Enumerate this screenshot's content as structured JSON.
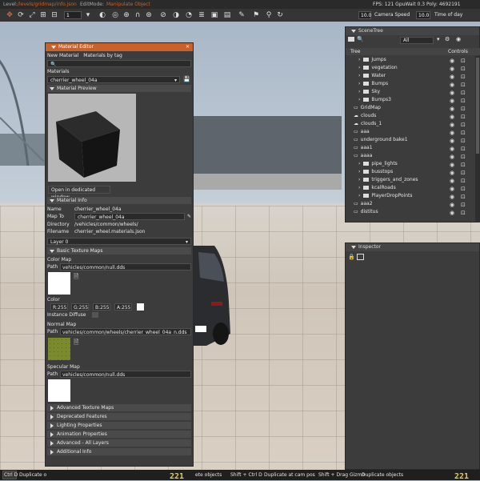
{
  "topbar": {
    "level_label": "Level:",
    "level_value": "/levels/gridmap/info.json",
    "edit_mode_label": "EditMode:",
    "edit_mode_value": "Manipulate Object",
    "stats": "FPS: 121  GpuWait 0.3  Poly: 4692191"
  },
  "toolbar": {
    "step_value": "1",
    "camera_speed_value": "10.0",
    "camera_speed_label": "Camera Speed",
    "time_value": "10.0",
    "time_label": "Time of day"
  },
  "material_editor": {
    "title": "Material Editor",
    "menu": [
      "New Material",
      "Materials by tag"
    ],
    "materials_label": "Materials",
    "selected_material": "cherrier_wheel_04a",
    "preview_header": "Material Preview",
    "open_window_button": "Open in dedicated window",
    "info_header": "Material Info",
    "info": [
      {
        "label": "Name",
        "value": "cherrier_wheel_04a"
      },
      {
        "label": "Map To",
        "value": "cherrier_wheel_04a"
      },
      {
        "label": "Directory",
        "value": "/vehicles/common/wheels/"
      },
      {
        "label": "Filename",
        "value": "cherrier_wheel.materials.json"
      }
    ],
    "layer": "Layer 0",
    "basic_maps_header": "Basic Texture Maps",
    "color_map": {
      "label": "Color Map",
      "path_label": "Path",
      "path": "vehicles/common/null.dds"
    },
    "color_label": "Color",
    "color_values": [
      "R:255",
      "G:255",
      "B:255",
      "A:255"
    ],
    "instance_diffuse_label": "Instance Diffuse",
    "normal_map": {
      "label": "Normal Map",
      "path_label": "Path",
      "path": "vehicles/common/wheels/cherrier_wheel_04a_n.dds"
    },
    "specular_map": {
      "label": "Specular Map",
      "path_label": "Path",
      "path": "vehicles/common/null.dds"
    },
    "collapsed_sections": [
      "Advanced Texture Maps",
      "Deprecated Features",
      "Lighting Properties",
      "Animation Properties",
      "Advanced - All Layers",
      "Additional Info"
    ]
  },
  "scene_tree": {
    "title": "SceneTree",
    "filter_value": "All",
    "col_tree": "Tree",
    "col_controls": "Controls",
    "items": [
      {
        "name": "Jumps",
        "type": "folder",
        "indent": 1
      },
      {
        "name": "vegetation",
        "type": "folder",
        "indent": 1
      },
      {
        "name": "Water",
        "type": "folder",
        "indent": 1
      },
      {
        "name": "Bumps",
        "type": "folder",
        "indent": 1
      },
      {
        "name": "Sky",
        "type": "folder",
        "indent": 1
      },
      {
        "name": "Bumps3",
        "type": "folder",
        "indent": 1
      },
      {
        "name": "GridMap",
        "type": "object",
        "indent": 0
      },
      {
        "name": "clouds",
        "type": "cloud",
        "indent": 0
      },
      {
        "name": "clouds_1",
        "type": "cloud",
        "indent": 0
      },
      {
        "name": "aaa",
        "type": "object",
        "indent": 0
      },
      {
        "name": "underground bake1",
        "type": "object",
        "indent": 0
      },
      {
        "name": "aaa1",
        "type": "object",
        "indent": 0
      },
      {
        "name": "aaaa",
        "type": "object",
        "indent": 0
      },
      {
        "name": "pipe_lights",
        "type": "folder",
        "indent": 1
      },
      {
        "name": "busstops",
        "type": "folder",
        "indent": 1
      },
      {
        "name": "triggers_and_zones",
        "type": "folder",
        "indent": 1
      },
      {
        "name": "kcalRoads",
        "type": "folder",
        "indent": 1
      },
      {
        "name": "PlayerDropPoints",
        "type": "folder",
        "indent": 1
      },
      {
        "name": "aaa2",
        "type": "object",
        "indent": 0
      },
      {
        "name": "distitus",
        "type": "object",
        "indent": 0
      }
    ]
  },
  "inspector": {
    "title": "Inspector"
  },
  "bottombar": {
    "hint1_key": "Ctrl D",
    "hint1_text": "Duplicate o",
    "fps_left": "221",
    "hint2_text": "ete objects",
    "hint3_key": "Shift + Ctrl D",
    "hint3_text": "Duplicate at cam pos",
    "hint4_key": "Shift + Drag Gizmo",
    "hint4_text": "Duplicate objects",
    "fps_right": "221"
  },
  "colors": {
    "accent": "#c9612a",
    "panel": "#3c3c3c",
    "fps": "#e7d23a"
  }
}
